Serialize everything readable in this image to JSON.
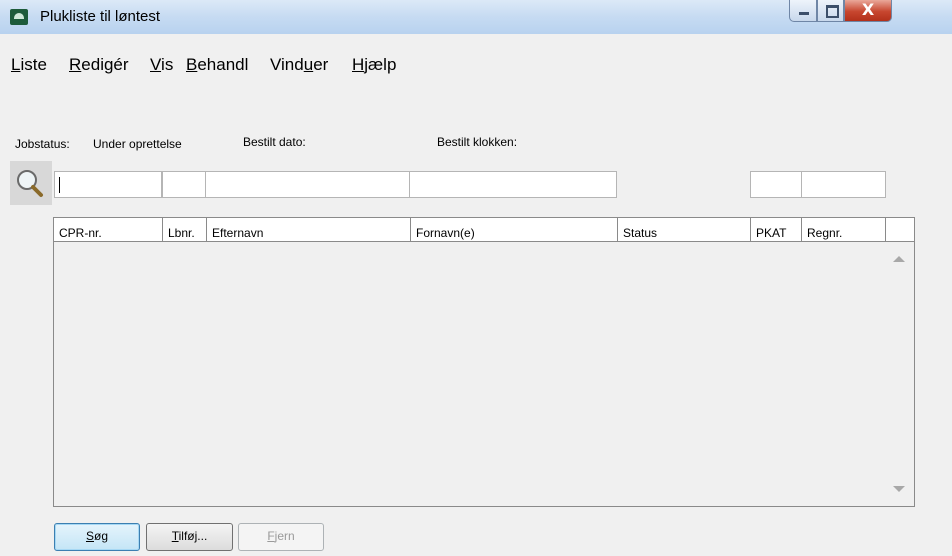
{
  "window": {
    "title": "Plukliste til løntest",
    "close_label": "X"
  },
  "menu": [
    {
      "accel": "L",
      "rest": "iste"
    },
    {
      "accel": "R",
      "rest": "edigér"
    },
    {
      "accel": "V",
      "rest": "is"
    },
    {
      "accel": "B",
      "rest": "ehandl"
    },
    {
      "pre": "Vind",
      "accel": "u",
      "rest": "er"
    },
    {
      "accel": "H",
      "rest": "jælp"
    }
  ],
  "info": {
    "jobstatus_label": "Jobstatus:",
    "jobstatus_value": "Under oprettelse",
    "bestilt_dato_label": "Bestilt dato:",
    "bestilt_klokken_label": "Bestilt klokken:"
  },
  "table": {
    "columns": [
      "CPR-nr.",
      "Lbnr.",
      "Efternavn",
      "Fornavn(e)",
      "Status",
      "PKAT",
      "Regnr."
    ],
    "rows": []
  },
  "buttons": {
    "sog": {
      "accel": "S",
      "rest": "øg"
    },
    "tilfoj": {
      "accel": "T",
      "rest": "ilføj..."
    },
    "fjern": {
      "accel": "F",
      "rest": "jern"
    }
  },
  "icons": [
    "app-icon",
    "minimize-icon",
    "maximize-icon",
    "close-icon",
    "search-icon",
    "scroll-up-icon",
    "scroll-down-icon"
  ]
}
